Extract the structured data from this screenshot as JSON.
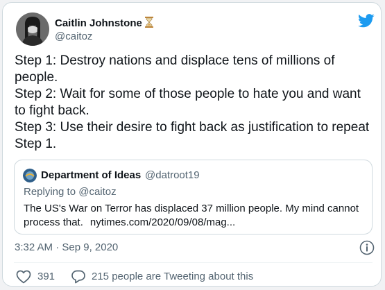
{
  "author": {
    "name": "Caitlin Johnstone",
    "handle": "@caitoz",
    "name_emoji": "hourglass-icon"
  },
  "tweet": {
    "lines": [
      "Step 1: Destroy nations and displace tens of millions of people.",
      "Step 2: Wait for some of those people to hate you and want to fight back.",
      "Step 3: Use their desire to fight back as justification to repeat Step 1."
    ]
  },
  "quoted": {
    "name": "Department of Ideas",
    "handle": "@datroot19",
    "replying_prefix": "Replying to",
    "replying_to": "@caitoz",
    "text": "The US's War on Terror has displaced 37 million people. My mind cannot process that.",
    "link": "nytimes.com/2020/09/08/mag..."
  },
  "meta": {
    "timestamp": "3:32 AM · Sep 9, 2020"
  },
  "actions": {
    "likes": "391",
    "conversation": "215 people are Tweeting about this"
  },
  "colors": {
    "brand_blue": "#1d9bf0",
    "text_primary": "#0f1419",
    "text_secondary": "#536471",
    "border": "#cfd9de"
  },
  "icons": {
    "logo": "twitter-bird-icon",
    "info": "info-icon",
    "like": "heart-icon",
    "conversation": "speech-bubble-icon"
  }
}
